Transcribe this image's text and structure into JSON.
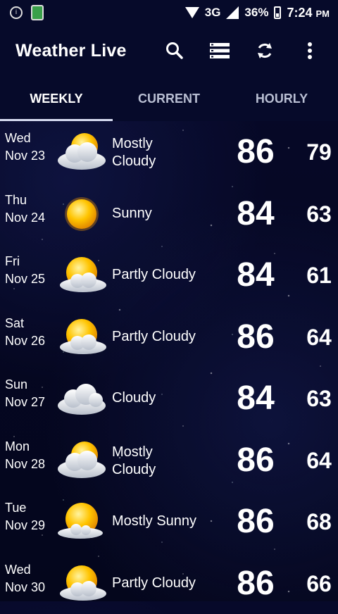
{
  "status_bar": {
    "time": "7:24",
    "ampm": "PM",
    "battery": "36%",
    "network": "3G"
  },
  "app": {
    "title": "Weather Live"
  },
  "tabs": [
    {
      "label": "WEEKLY",
      "active": true
    },
    {
      "label": "CURRENT",
      "active": false
    },
    {
      "label": "HOURLY",
      "active": false
    }
  ],
  "forecast": [
    {
      "day": "Wed",
      "date": "Nov 23",
      "cond1": "Mostly",
      "cond2": "Cloudy",
      "icon": "mostly-cloudy-icon",
      "hi": "86",
      "lo": "79"
    },
    {
      "day": "Thu",
      "date": "Nov 24",
      "cond1": "Sunny",
      "cond2": "",
      "icon": "sunny-icon",
      "hi": "84",
      "lo": "63"
    },
    {
      "day": "Fri",
      "date": "Nov 25",
      "cond1": "Partly Cloudy",
      "cond2": "",
      "icon": "partly-cloudy-icon",
      "hi": "84",
      "lo": "61"
    },
    {
      "day": "Sat",
      "date": "Nov 26",
      "cond1": "Partly Cloudy",
      "cond2": "",
      "icon": "partly-cloudy-icon",
      "hi": "86",
      "lo": "64"
    },
    {
      "day": "Sun",
      "date": "Nov 27",
      "cond1": "Cloudy",
      "cond2": "",
      "icon": "cloudy-icon",
      "hi": "84",
      "lo": "63"
    },
    {
      "day": "Mon",
      "date": "Nov 28",
      "cond1": "Mostly",
      "cond2": "Cloudy",
      "icon": "mostly-cloudy-icon",
      "hi": "86",
      "lo": "64"
    },
    {
      "day": "Tue",
      "date": "Nov 29",
      "cond1": "Mostly Sunny",
      "cond2": "",
      "icon": "mostly-sunny-icon",
      "hi": "86",
      "lo": "68"
    },
    {
      "day": "Wed",
      "date": "Nov 30",
      "cond1": "Partly Cloudy",
      "cond2": "",
      "icon": "partly-cloudy-icon",
      "hi": "86",
      "lo": "66"
    }
  ],
  "colors": {
    "bar_bg": "#060a2a",
    "sun": "#f6b800",
    "cloud": "#e9edf3",
    "tab_indicator": "#d6dbf0"
  }
}
